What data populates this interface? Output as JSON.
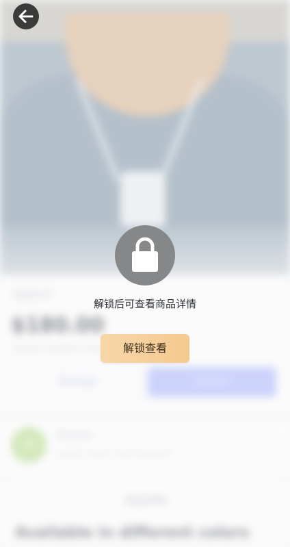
{
  "back_button": {
    "icon": "arrow-left-icon"
  },
  "product": {
    "tag": "JEWELRY",
    "price": "$180.00",
    "subtitle": "Jewelry pendant necklace",
    "button_outline_label": "Message",
    "button_filled_label": "Contact"
  },
  "seller": {
    "avatar_text": "VR",
    "name": "Vincent",
    "meta": "Jewelry  store  chain  pendant",
    "chevron": "›"
  },
  "details": {
    "tab_label": "商品详情",
    "headline": "Available in different colors"
  },
  "lock": {
    "icon": "lock-icon",
    "caption": "解锁后可查看商品详情",
    "button_label": "解锁查看"
  },
  "colors": {
    "lock_circle": "#858789",
    "unlock_button_start": "#f7d6a8",
    "unlock_button_end": "#f6c98f",
    "back_button": "#3b3b3b"
  }
}
